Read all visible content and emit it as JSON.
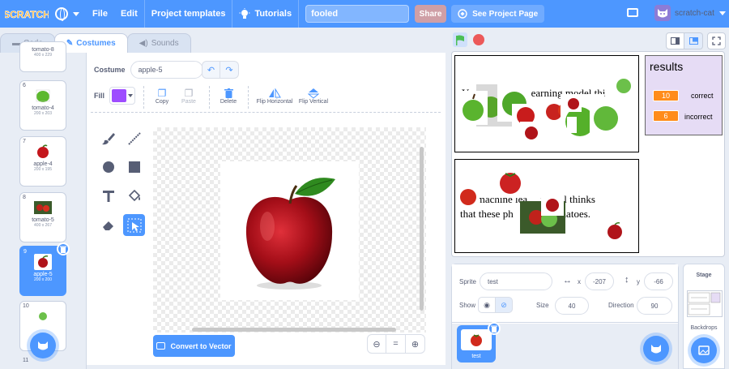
{
  "menu": {
    "logo": "SCRATCH",
    "file": "File",
    "edit": "Edit",
    "project_templates": "Project templates",
    "tutorials": "Tutorials",
    "project_title": "fooled",
    "share": "Share",
    "see_project_page": "See Project Page",
    "username": "scratch-cat"
  },
  "tabs": {
    "code": "Code",
    "costumes": "Costumes",
    "sounds": "Sounds"
  },
  "costumes": [
    {
      "num": "",
      "name": "tomato-8",
      "size": "400 x 229"
    },
    {
      "num": "6",
      "name": "tomato-4",
      "size": "200 x 203"
    },
    {
      "num": "7",
      "name": "apple-4",
      "size": "200 x 195"
    },
    {
      "num": "8",
      "name": "tomato-5",
      "size": "400 x 267"
    },
    {
      "num": "9",
      "name": "apple-5",
      "size": "200 x 200"
    },
    {
      "num": "10",
      "name": "",
      "size": ""
    },
    {
      "num": "11",
      "name": "",
      "size": ""
    }
  ],
  "editor": {
    "costume_label": "Costume",
    "costume_name": "apple-5",
    "fill_label": "Fill",
    "copy": "Copy",
    "paste": "Paste",
    "delete": "Delete",
    "flip_horizontal": "Flip Horizontal",
    "flip_vertical": "Flip Vertical",
    "convert_to_vector": "Convert to Vector",
    "fill_color": "#9e4dff"
  },
  "stage": {
    "panel1_text_parts": [
      "Yo",
      "learning model thi",
      "th",
      "s"
    ],
    "panel2_text_line1": "T    machine lea     model thinks",
    "panel2_text_line2": "that these ph        ike tomatoes.",
    "results_title": "results",
    "correct_value": "10",
    "correct_label": "correct",
    "incorrect_value": "6",
    "incorrect_label": "incorrect"
  },
  "sprite_info": {
    "sprite_label": "Sprite",
    "sprite_name": "test",
    "x_label": "x",
    "x_value": "-207",
    "y_label": "y",
    "y_value": "-66",
    "show_label": "Show",
    "size_label": "Size",
    "size_value": "40",
    "direction_label": "Direction",
    "direction_value": "90",
    "sprite_tile_name": "test"
  },
  "stage_pane": {
    "title": "Stage",
    "backdrops_label": "Backdrops"
  },
  "colors": {
    "accent": "#4d97ff",
    "counter": "#ff8c1a",
    "stop": "#ec5959"
  }
}
